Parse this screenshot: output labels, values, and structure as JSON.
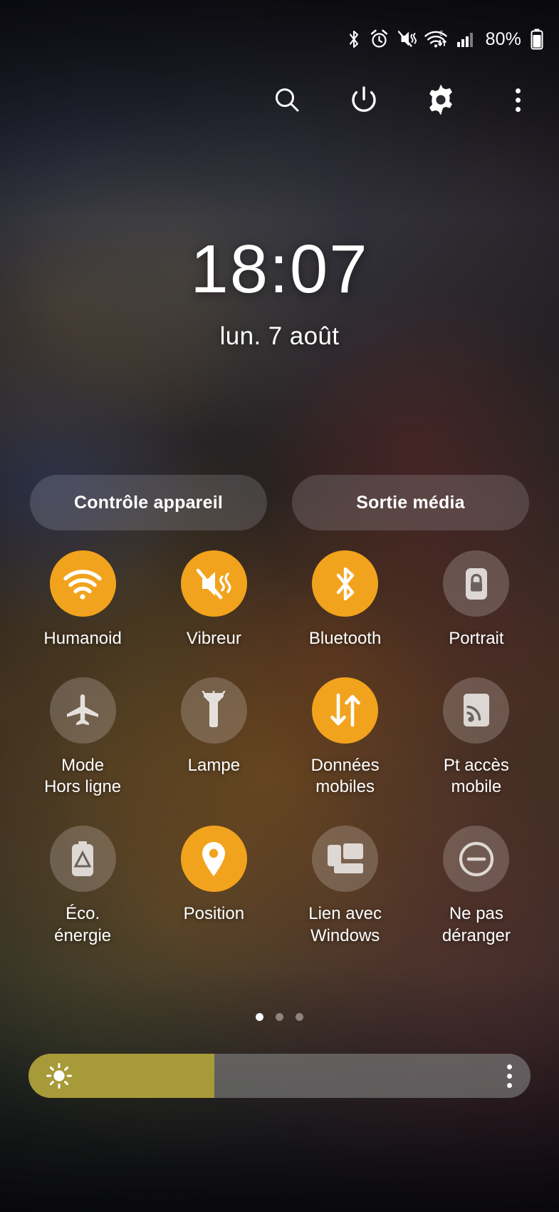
{
  "status_bar": {
    "icons": [
      "bluetooth-icon",
      "alarm-icon",
      "mute-vibrate-icon",
      "wifi-6-data-icon",
      "cellular-signal-icon"
    ],
    "wifi_generation": "6",
    "battery_percent": "80%"
  },
  "header": {
    "buttons": [
      {
        "name": "search-button",
        "icon": "search-icon"
      },
      {
        "name": "power-button",
        "icon": "power-icon"
      },
      {
        "name": "settings-button",
        "icon": "gear-icon"
      },
      {
        "name": "more-options-button",
        "icon": "kebab-menu-icon"
      }
    ]
  },
  "clock": {
    "time": "18:07",
    "date": "lun. 7 août"
  },
  "pills": [
    {
      "label": "Contrôle appareil"
    },
    {
      "label": "Sortie média"
    }
  ],
  "tiles": [
    {
      "label": "Humanoid",
      "icon": "wifi-icon",
      "state": "on"
    },
    {
      "label": "Vibreur",
      "icon": "vibrate-icon",
      "state": "on"
    },
    {
      "label": "Bluetooth",
      "icon": "bluetooth-icon",
      "state": "on"
    },
    {
      "label": "Portrait",
      "icon": "rotation-lock-icon",
      "state": "off"
    },
    {
      "label": "Mode\nHors ligne",
      "icon": "airplane-icon",
      "state": "off"
    },
    {
      "label": "Lampe",
      "icon": "flashlight-icon",
      "state": "off"
    },
    {
      "label": "Données\nmobiles",
      "icon": "mobile-data-icon",
      "state": "on"
    },
    {
      "label": "Pt accès\nmobile",
      "icon": "hotspot-icon",
      "state": "off"
    },
    {
      "label": "Éco.\nénergie",
      "icon": "power-saving-icon",
      "state": "off"
    },
    {
      "label": "Position",
      "icon": "location-pin-icon",
      "state": "on"
    },
    {
      "label": "Lien avec\nWindows",
      "icon": "link-to-windows-icon",
      "state": "off"
    },
    {
      "label": "Ne pas\ndéranger",
      "icon": "do-not-disturb-icon",
      "state": "off"
    }
  ],
  "pagination": {
    "total": 3,
    "active_index": 0
  },
  "brightness": {
    "level_percent": 37,
    "fill_color": "#a79a38",
    "track_color": "#828282",
    "sun_icon": "brightness-sun-icon",
    "menu_icon": "kebab-menu-icon"
  },
  "theme": {
    "accent_on": "#f2a31d",
    "tile_off": "rgba(215,205,200,0.26)",
    "text": "#ffffff"
  }
}
